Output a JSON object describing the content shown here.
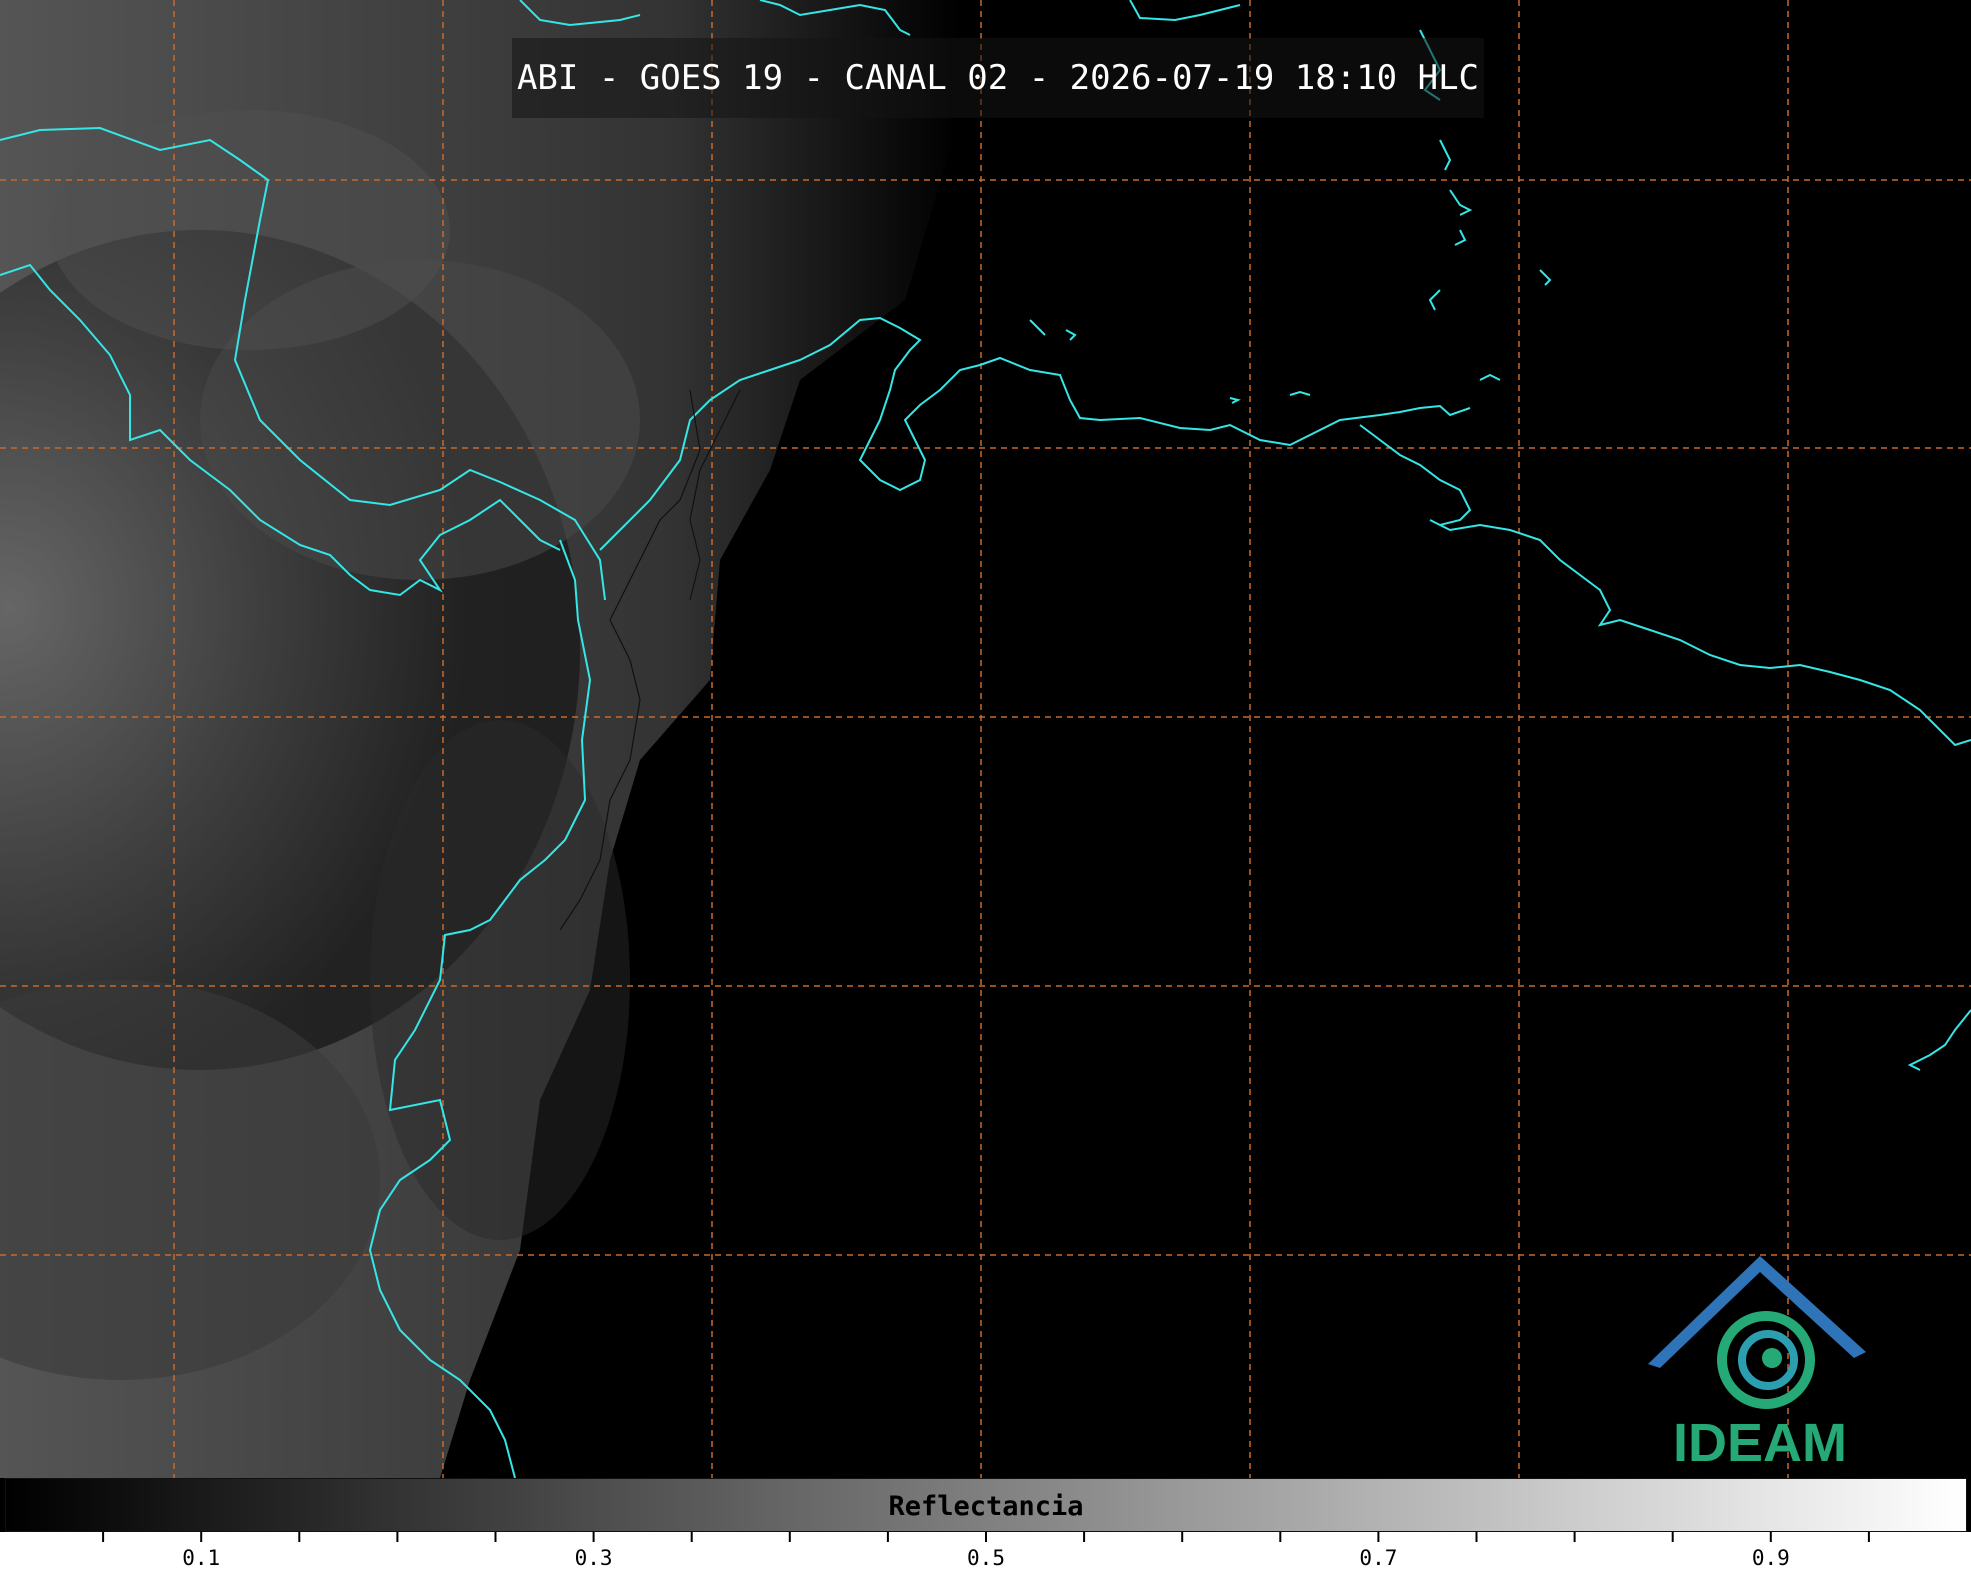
{
  "title": "ABI - GOES 19 - CANAL 02 - 2026-07-19 18:10 HLC",
  "colorbar": {
    "label": "Reflectancia",
    "range": [
      0.0,
      1.0
    ],
    "colormap": [
      "#000000",
      "#ffffff"
    ],
    "ticks": [
      {
        "value": 0.1,
        "label": "0.1"
      },
      {
        "value": 0.3,
        "label": "0.3"
      },
      {
        "value": 0.5,
        "label": "0.5"
      },
      {
        "value": 0.7,
        "label": "0.7"
      },
      {
        "value": 0.9,
        "label": "0.9"
      }
    ],
    "minor_tick_step": 0.05
  },
  "logo": {
    "text": "IDEAM"
  },
  "colors": {
    "coastline": "#35e6e6",
    "gridline": "#c86a2a",
    "background": "#000000",
    "logo_blue": "#2f73b8",
    "logo_green": "#24a977"
  }
}
